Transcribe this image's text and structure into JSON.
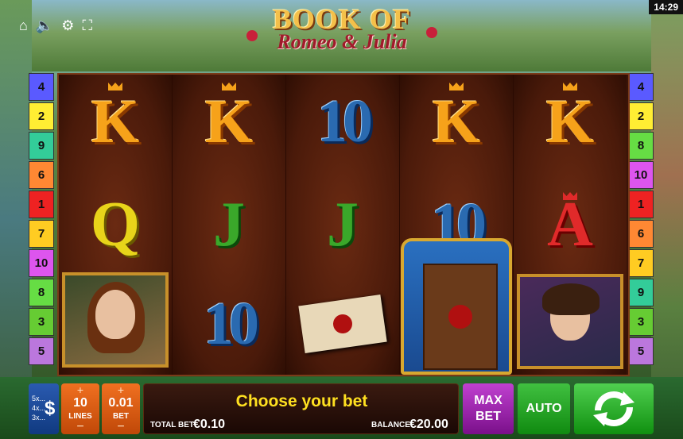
{
  "status_bar": {
    "time": "14:29"
  },
  "toolbar": {
    "home_icon": "home-icon",
    "sound_icon": "speaker-icon",
    "settings_icon": "gear-icon",
    "fullscreen_icon": "fullscreen-icon"
  },
  "logo": {
    "line1": "BOOK OF",
    "line2": "Romeo & Julia"
  },
  "paylines_left": [
    {
      "label": "4",
      "color": "#5a5aff"
    },
    {
      "label": "2",
      "color": "#ffee33"
    },
    {
      "label": "9",
      "color": "#33cc99"
    },
    {
      "label": "6",
      "color": "#ff8833"
    },
    {
      "label": "1",
      "color": "#ee2222"
    },
    {
      "label": "7",
      "color": "#ffcc22"
    },
    {
      "label": "10",
      "color": "#dd55ee"
    },
    {
      "label": "8",
      "color": "#66dd44"
    },
    {
      "label": "3",
      "color": "#66cc33"
    },
    {
      "label": "5",
      "color": "#bb77dd"
    }
  ],
  "paylines_right": [
    {
      "label": "4",
      "color": "#5a5aff"
    },
    {
      "label": "2",
      "color": "#ffee33"
    },
    {
      "label": "8",
      "color": "#66dd44"
    },
    {
      "label": "10",
      "color": "#dd55ee"
    },
    {
      "label": "1",
      "color": "#ee2222"
    },
    {
      "label": "6",
      "color": "#ff8833"
    },
    {
      "label": "7",
      "color": "#ffcc22"
    },
    {
      "label": "9",
      "color": "#33cc99"
    },
    {
      "label": "3",
      "color": "#66cc33"
    },
    {
      "label": "5",
      "color": "#bb77dd"
    }
  ],
  "reels": {
    "row1": [
      "K",
      "K",
      "10",
      "K",
      "K"
    ],
    "row2": [
      "Q",
      "J",
      "J",
      "10",
      "A"
    ],
    "row3": [
      "julia",
      "10",
      "letter",
      "book",
      "romeo"
    ]
  },
  "controls": {
    "coin_values": [
      "5x...",
      "4x...",
      "3x..."
    ],
    "coins_icon": "dollar-icon",
    "lines_plus": "+",
    "lines_value": "10",
    "lines_label": "LINES",
    "lines_minus": "−",
    "bet_plus": "+",
    "bet_value": "0.01",
    "bet_label": "BET",
    "bet_minus": "−",
    "message": "Choose your bet",
    "total_bet_label": "TOTAL BET",
    "total_bet_value": "€0.10",
    "balance_label": "BALANCE",
    "balance_value": "€20.00",
    "max_bet_line1": "MAX",
    "max_bet_line2": "BET",
    "auto_label": "AUTO",
    "spin_icon": "spin-arrows-icon"
  }
}
